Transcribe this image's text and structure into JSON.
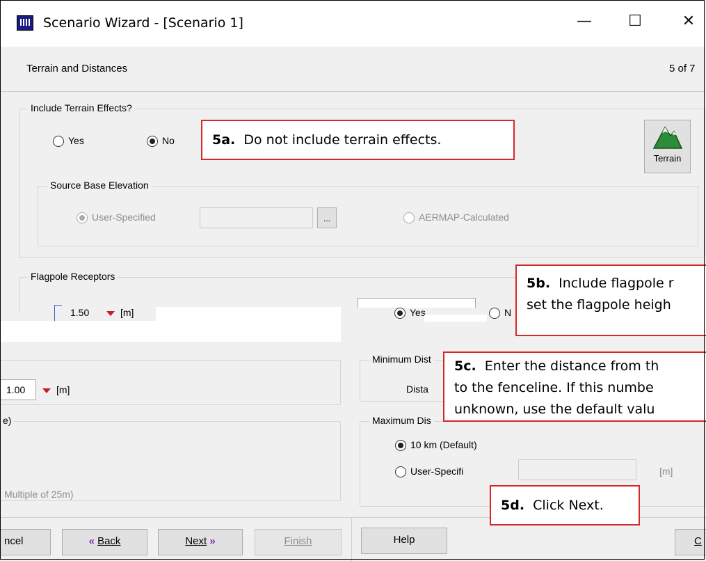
{
  "window": {
    "title": "Scenario Wizard - [Scenario 1]",
    "minimize": "—",
    "maximize": "☐",
    "close": "✕"
  },
  "header": {
    "title": "Terrain and Distances",
    "step": "5 of 7"
  },
  "terrain": {
    "legend": "Include Terrain Effects?",
    "yes_label": "Yes",
    "no_label": "No",
    "selected": "No",
    "terrain_button": "Terrain",
    "source_base": {
      "legend": "Source Base Elevation",
      "user_specified": "User-Specified",
      "browse": "...",
      "aermap": "AERMAP-Calculated",
      "selected": "User-Specified"
    }
  },
  "flagpole": {
    "legend": "Flagpole Receptors",
    "height_value": "1.50",
    "height_unit": "[m]",
    "yes_label": "Yes",
    "no_label": "N",
    "selected": "Yes"
  },
  "left_panel": {
    "value": "1.00",
    "unit": "[m]",
    "fragment_legend": "e)",
    "fragment_text": "Multiple of 25m)"
  },
  "min_distance": {
    "legend": "Minimum Dist",
    "label": "Dista"
  },
  "max_distance": {
    "legend": "Maximum Dis",
    "default_label": "10 km (Default)",
    "user_label": "User-Specifi",
    "unit": "[m]",
    "selected": "10 km (Default)"
  },
  "buttons": {
    "cancel": "ncel",
    "back": "Back",
    "next": "Next",
    "finish": "Finish",
    "help": "Help",
    "close_fragment": "C"
  },
  "callouts": {
    "a_num": "5a.",
    "a_text": "Do not include terrain effects.",
    "b_num": "5b.",
    "b_line1": "Include flagpole r",
    "b_line2": "set the flagpole heigh",
    "c_num": "5c.",
    "c_line1": "Enter the distance from th",
    "c_line2": "to the fenceline.  If this numbe",
    "c_line3": "unknown, use the default valu",
    "d_num": "5d.",
    "d_text": "Click Next."
  }
}
